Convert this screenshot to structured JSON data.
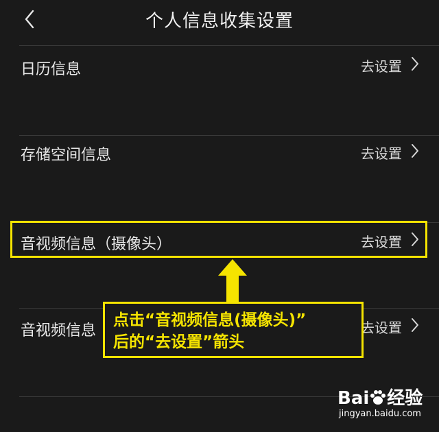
{
  "header": {
    "title": "个人信息收集设置",
    "back_icon": "chevron-left-icon"
  },
  "rows": [
    {
      "label": "日历信息",
      "action": "去设置"
    },
    {
      "label": "存储空间信息",
      "action": "去设置"
    },
    {
      "label": "音视频信息（摄像头）",
      "action": "去设置"
    },
    {
      "label": "音视频信息",
      "action": "去设置"
    }
  ],
  "annotation": {
    "line1": "点击“音视频信息(摄像头)”",
    "line2": "后的“去设置”箭头",
    "color": "#f5e400"
  },
  "watermark": {
    "logo_left": "Bai",
    "logo_right": "经验",
    "url": "jingyan.baidu.com"
  }
}
